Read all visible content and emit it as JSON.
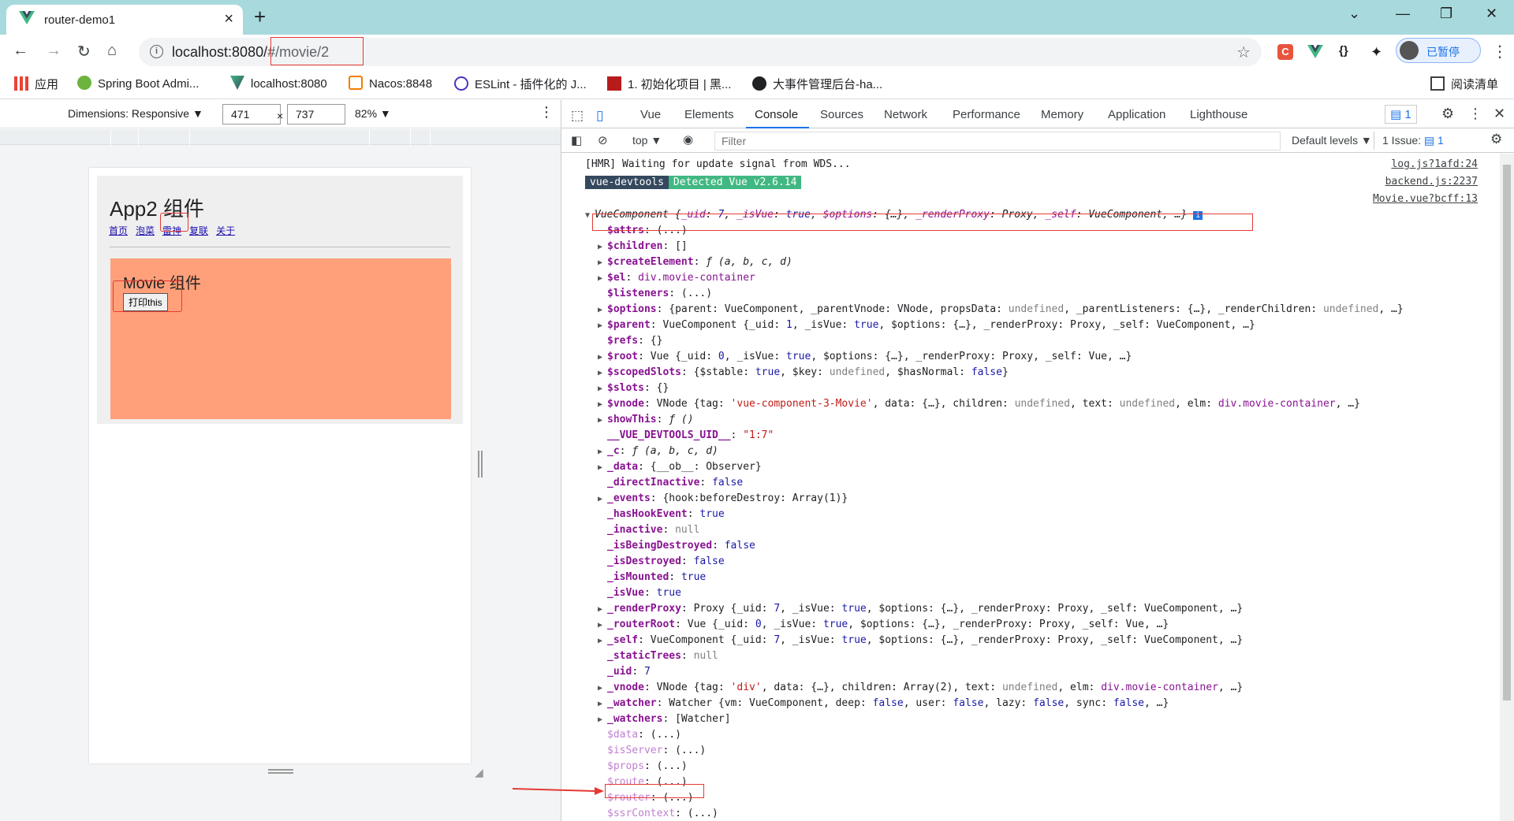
{
  "browser": {
    "tab_title": "router-demo1",
    "url_host": "localhost:8080/",
    "url_hash": "#/movie/2",
    "profile_label": "已暂停",
    "bookmarks": [
      "应用",
      "Spring Boot Admi...",
      "localhost:8080",
      "Nacos:8848",
      "ESLint - 插件化的 J...",
      "1. 初始化项目 | 黑...",
      "大事件管理后台-ha..."
    ],
    "reading_list": "阅读清单"
  },
  "device_toolbar": {
    "dimensions_label": "Dimensions: Responsive ▼",
    "width": "471",
    "times": "×",
    "height": "737",
    "zoom": "82% ▼"
  },
  "page": {
    "app_title": "App2 组件",
    "links": [
      "首页",
      "泡菜",
      "雷神",
      "复联",
      "关于"
    ],
    "movie_title": "Movie 组件",
    "button_label": "打印this"
  },
  "devtools": {
    "tabs": [
      "Vue",
      "Elements",
      "Console",
      "Sources",
      "Network",
      "Performance",
      "Memory",
      "Application",
      "Lighthouse"
    ],
    "active_tab": "Console",
    "issues_badge": "1",
    "context": "top",
    "filter_placeholder": "Filter",
    "levels": "Default levels ▼",
    "issue_count": "1 Issue:",
    "issue_num": "1"
  },
  "console": {
    "hmr_line": "[HMR] Waiting for update signal from WDS...",
    "hmr_src": "log.js?1afd:24",
    "devtools_badge": "vue-devtools",
    "detected_badge": "Detected Vue v2.6.14",
    "backend_src": "backend.js:2237",
    "movie_src": "Movie.vue?bcff:13"
  },
  "colors": {
    "titlebar": "#a8dadd",
    "movie_bg": "#ffa07a",
    "highlight": "#e53935",
    "vue_green": "#41b883",
    "vue_dark": "#35495e"
  }
}
